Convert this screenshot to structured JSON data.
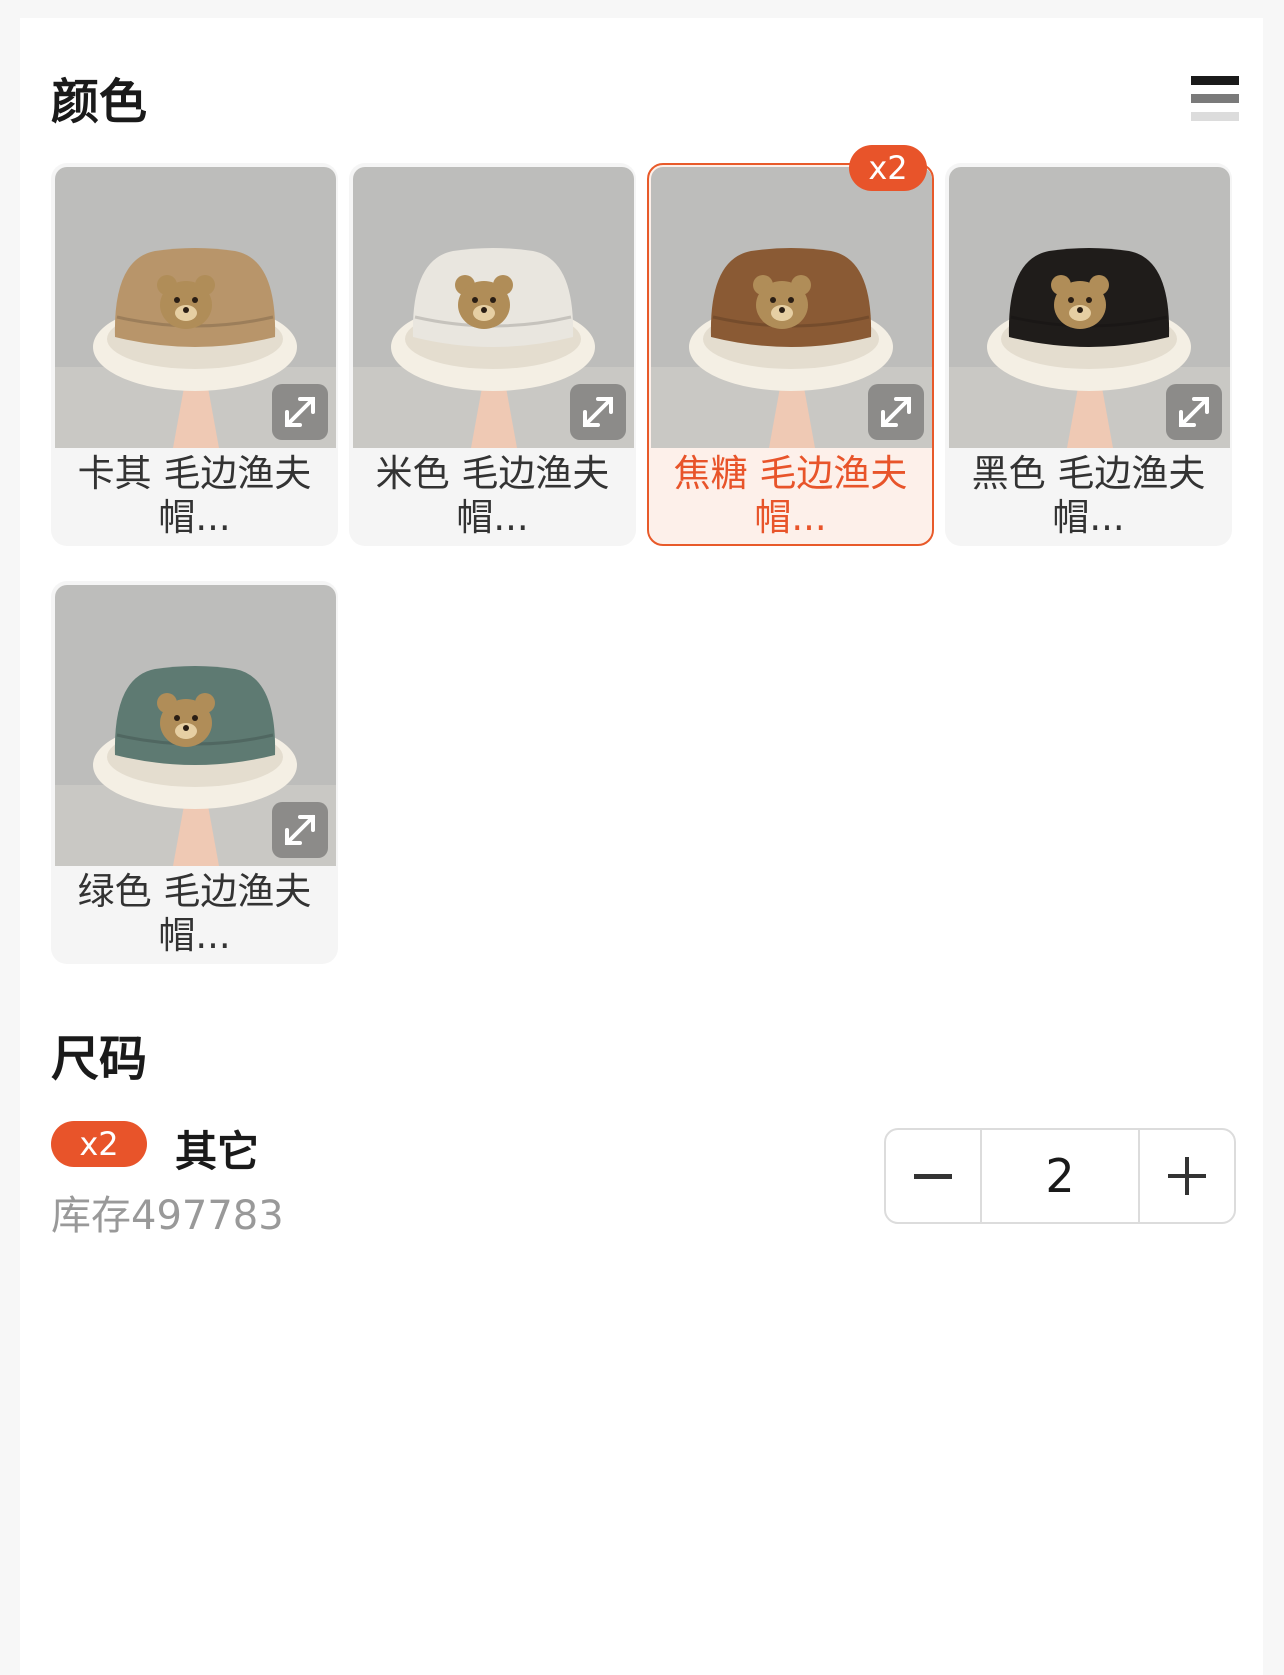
{
  "color_section": {
    "title": "颜色",
    "options": [
      {
        "label": "卡其 毛边渔夫帽...",
        "hat_color": "#b8956a",
        "badge": ""
      },
      {
        "label": "米色 毛边渔夫帽...",
        "hat_color": "#e9e6df",
        "badge": ""
      },
      {
        "label": "焦糖 毛边渔夫帽...",
        "hat_color": "#8a5a34",
        "badge": "x2",
        "selected": true
      },
      {
        "label": "黑色 毛边渔夫帽...",
        "hat_color": "#1f1c1a",
        "badge": ""
      },
      {
        "label": "绿色 毛边渔夫帽...",
        "hat_color": "#5e7a72",
        "badge": ""
      }
    ]
  },
  "size_section": {
    "title": "尺码",
    "badge": "x2",
    "name": "其它",
    "stock": "库存497783",
    "quantity": "2"
  },
  "colors": {
    "accent": "#e8542a"
  }
}
